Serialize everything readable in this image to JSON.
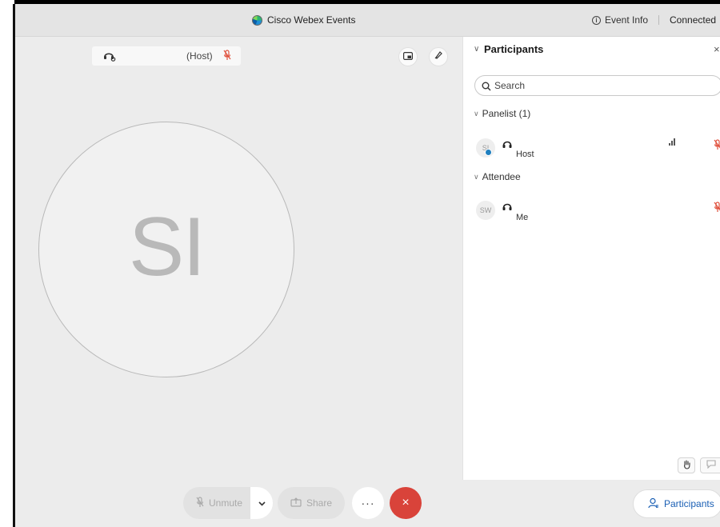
{
  "titlebar": {
    "app_title": "Cisco Webex Events",
    "event_info_label": "Event Info",
    "connection_status": "Connected"
  },
  "stage": {
    "name_label_role": "(Host)",
    "avatar_initials": "SI"
  },
  "participants_panel": {
    "title": "Participants",
    "search_placeholder": "Search",
    "sections": [
      {
        "label": "Panelist (1)",
        "members": [
          {
            "initials": "SI",
            "role": "Host"
          }
        ]
      },
      {
        "label": "Attendee",
        "members": [
          {
            "initials": "SW",
            "role": "Me"
          }
        ]
      }
    ]
  },
  "controls": {
    "unmute_label": "Unmute",
    "share_label": "Share",
    "more_label": "···",
    "leave_label": "×",
    "participants_label": "Participants"
  },
  "colors": {
    "leave_red": "#d9433a",
    "accent_blue": "#1a5fb4",
    "mic_muted_red": "#e0513d"
  }
}
